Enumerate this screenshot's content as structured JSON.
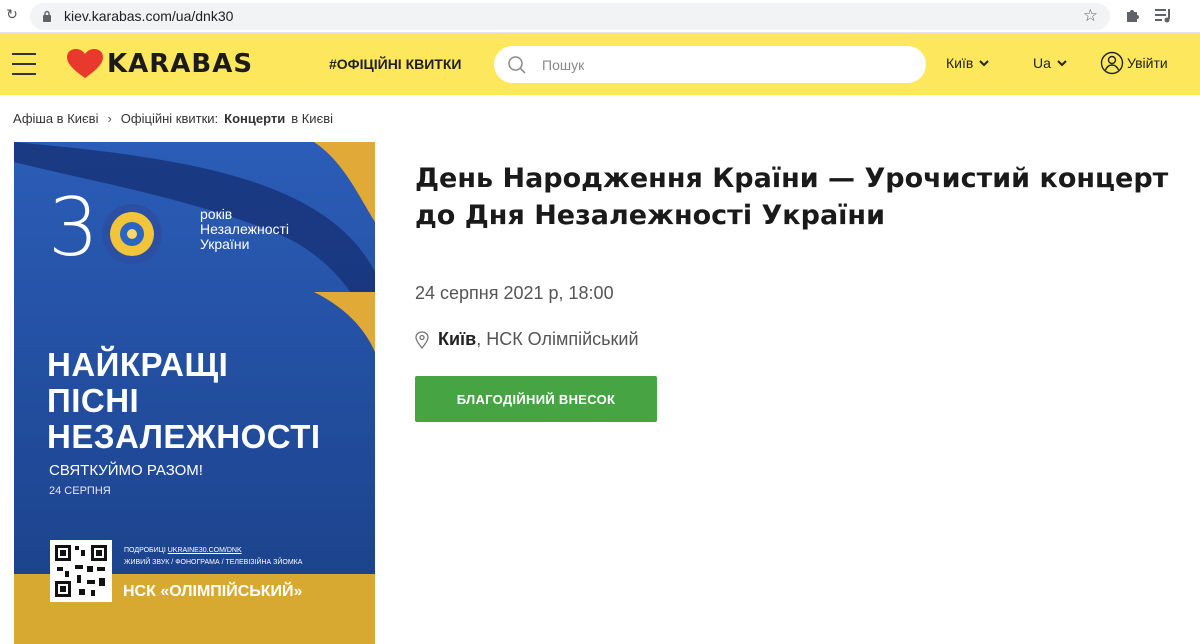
{
  "browser": {
    "url": "kiev.karabas.com/ua/dnk30"
  },
  "header": {
    "logo_text": "KARABAS",
    "tagline": "#ОФІЦІЙНІ КВИТКИ",
    "search_placeholder": "Пошук",
    "city": "Київ",
    "language": "Ua",
    "login_label": "Увійти",
    "colors": {
      "background": "#fde85d",
      "logo_heart": "#e8392c"
    }
  },
  "breadcrumb": {
    "items": [
      "Афіша в Києві",
      "Офіційні квитки:",
      "Концерти",
      "в Києві"
    ],
    "separator": "›"
  },
  "poster": {
    "number": "3",
    "years_line1": "років",
    "years_line2": "Незалежності",
    "years_line3": "України",
    "title_line1": "НАЙКРАЩІ",
    "title_line2": "ПІСНІ",
    "title_line3": "НЕЗАЛЕЖНОСТІ",
    "subtitle": "СВЯТКУЙМО РАЗОМ!",
    "date": "24 СЕРПНЯ",
    "details_prefix": "ПОДРОБИЦІ",
    "details_link": "UKRAINE30.COM/DNK",
    "details_line2": "ЖИВИЙ ЗВУК / ФОНОГРАМА / ТЕЛЕВІЗІЙНА ЗЙОМКА",
    "venue": "НСК «ОЛІМПІЙСЬКИЙ»"
  },
  "event": {
    "title": "День Народження Країни — Урочистий концерт до Дня Незалежності України",
    "datetime": "24 серпня 2021 р, 18:00",
    "city": "Київ",
    "venue": ", НСК Олімпійський",
    "button_label": "БЛАГОДІЙНИЙ ВНЕСОК",
    "button_color": "#46a443"
  }
}
